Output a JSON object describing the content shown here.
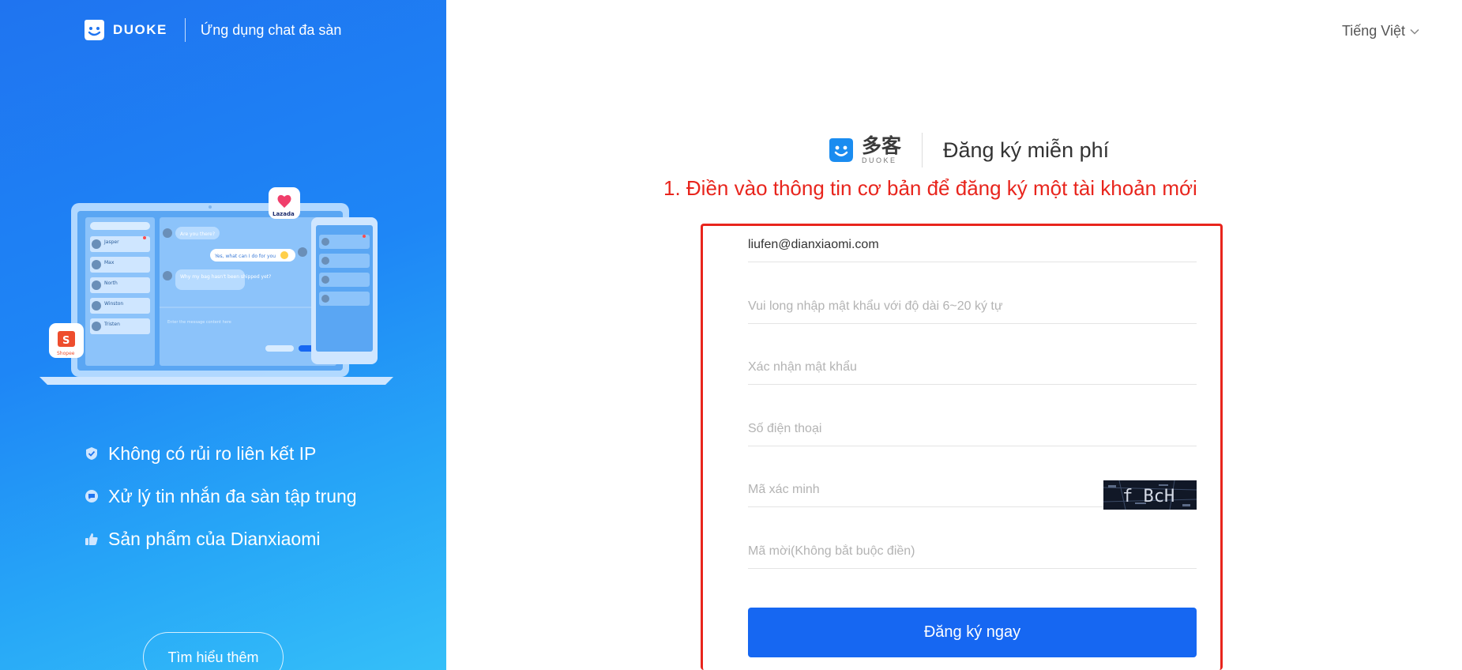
{
  "brand": {
    "name": "DUOKE",
    "tagline": "Ứng dụng chat đa sàn"
  },
  "illustration": {
    "platforms": [
      "Lazada",
      "Shopee"
    ],
    "chat_list": [
      "Jasper",
      "Max",
      "North",
      "Winston",
      "Tristen"
    ],
    "messages": [
      "Are you there?",
      "Yes, what can I do for you",
      "Why my bag hasn't been shipped yet?"
    ],
    "input_placeholder": "Enter the message content here"
  },
  "features": [
    {
      "icon": "shield-icon",
      "label": "Không có rủi ro liên kết IP"
    },
    {
      "icon": "chat-bubble-icon",
      "label": "Xử lý tin nhắn đa sàn tập trung"
    },
    {
      "icon": "thumbs-up-icon",
      "label": "Sản phẩm của Dianxiaomi"
    }
  ],
  "learn_more_label": "Tìm hiểu thêm",
  "language": {
    "selected": "Tiếng Việt"
  },
  "form_header": {
    "logo_cn": "多客",
    "logo_en": "DUOKE",
    "title": "Đăng ký miễn phí"
  },
  "instruction": "1. Điền vào thông tin cơ bản để đăng ký một tài khoản mới",
  "form": {
    "email": {
      "value": "liufen@dianxiaomi.com",
      "placeholder": ""
    },
    "password": {
      "value": "",
      "placeholder": "Vui long nhập mật khẩu với độ dài 6~20 ký tự"
    },
    "confirm_password": {
      "value": "",
      "placeholder": "Xác nhận mật khẩu"
    },
    "phone": {
      "value": "",
      "placeholder": "Số điện thoại"
    },
    "captcha": {
      "value": "",
      "placeholder": "Mã xác minh",
      "image_text": "f BcH"
    },
    "invite_code": {
      "value": "",
      "placeholder": "Mã mời(Không bắt buộc điền)"
    },
    "submit_label": "Đăng ký ngay"
  },
  "colors": {
    "accent": "#1667f2",
    "annotation_red": "#e8251d",
    "panel_blue": "#1f74f0"
  }
}
